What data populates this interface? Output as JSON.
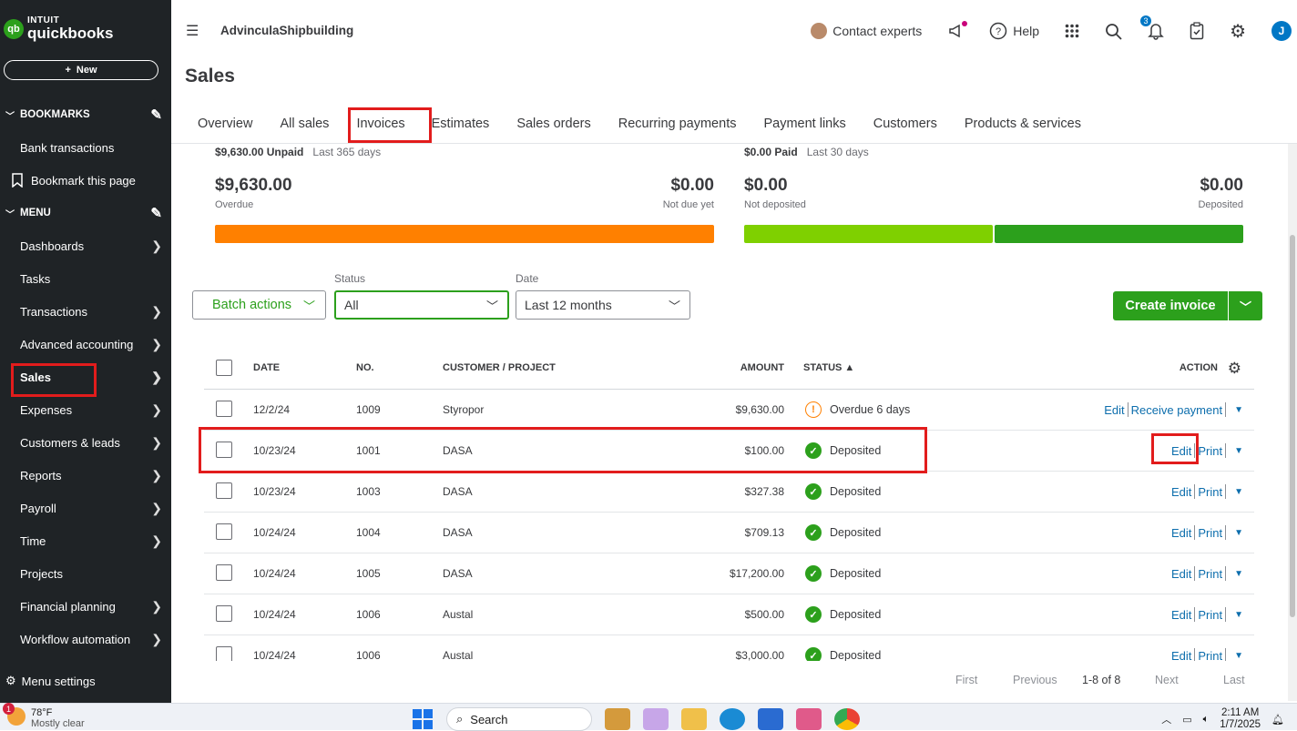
{
  "sidebar": {
    "logo_intuit": "INTUIT",
    "logo_qb": "quickbooks",
    "logo_mark": "qb",
    "new_label": "New",
    "bookmarks_label": "BOOKMARKS",
    "bookmark_items": [
      "Bank transactions",
      "Bookmark this page"
    ],
    "menu_label": "MENU",
    "menu_items": [
      "Dashboards",
      "Tasks",
      "Transactions",
      "Advanced accounting",
      "Sales",
      "Expenses",
      "Customers & leads",
      "Reports",
      "Payroll",
      "Time",
      "Projects",
      "Financial planning",
      "Workflow automation"
    ],
    "menu_settings": "Menu settings"
  },
  "topbar": {
    "company": "AdvinculaShipbuilding",
    "contact": "Contact experts",
    "help": "Help",
    "notif_count": "3",
    "user_initial": "J"
  },
  "page": {
    "title": "Sales",
    "tabs": [
      "Overview",
      "All sales",
      "Invoices",
      "Estimates",
      "Sales orders",
      "Recurring payments",
      "Payment links",
      "Customers",
      "Products & services"
    ]
  },
  "summary": {
    "unpaid_head": "$9,630.00 Unpaid",
    "unpaid_period": "Last 365 days",
    "overdue_amount": "$9,630.00",
    "overdue_label": "Overdue",
    "notdue_amount": "$0.00",
    "notdue_label": "Not due yet",
    "paid_head": "$0.00 Paid",
    "paid_period": "Last 30 days",
    "notdep_amount": "$0.00",
    "notdep_label": "Not deposited",
    "dep_amount": "$0.00",
    "dep_label": "Deposited",
    "colors": {
      "overdue": "#ff8000",
      "notdeposited": "#7fd000",
      "deposited": "#2ca01c"
    }
  },
  "filters": {
    "batch": "Batch actions",
    "status_label": "Status",
    "status_value": "All",
    "date_label": "Date",
    "date_value": "Last 12 months",
    "create": "Create invoice"
  },
  "table": {
    "headers": {
      "date": "DATE",
      "no": "NO.",
      "customer": "CUSTOMER / PROJECT",
      "amount": "AMOUNT",
      "status": "STATUS ▲",
      "action": "ACTION"
    },
    "rows": [
      {
        "date": "12/2/24",
        "no": "1009",
        "customer": "Styropor",
        "amount": "$9,630.00",
        "status": "Overdue 6 days",
        "a1": "Edit",
        "a2": "Receive payment"
      },
      {
        "date": "10/23/24",
        "no": "1001",
        "customer": "DASA",
        "amount": "$100.00",
        "status": "Deposited",
        "a1": "Edit",
        "a2": "Print"
      },
      {
        "date": "10/23/24",
        "no": "1003",
        "customer": "DASA",
        "amount": "$327.38",
        "status": "Deposited",
        "a1": "Edit",
        "a2": "Print"
      },
      {
        "date": "10/24/24",
        "no": "1004",
        "customer": "DASA",
        "amount": "$709.13",
        "status": "Deposited",
        "a1": "Edit",
        "a2": "Print"
      },
      {
        "date": "10/24/24",
        "no": "1005",
        "customer": "DASA",
        "amount": "$17,200.00",
        "status": "Deposited",
        "a1": "Edit",
        "a2": "Print"
      },
      {
        "date": "10/24/24",
        "no": "1006",
        "customer": "Austal",
        "amount": "$500.00",
        "status": "Deposited",
        "a1": "Edit",
        "a2": "Print"
      },
      {
        "date": "10/24/24",
        "no": "1006",
        "customer": "Austal",
        "amount": "$3,000.00",
        "status": "Deposited",
        "a1": "Edit",
        "a2": "Print"
      }
    ]
  },
  "pager": {
    "first": "First",
    "previous": "Previous",
    "range": "1-8 of 8",
    "next": "Next",
    "last": "Last"
  },
  "taskbar": {
    "temp": "78°F",
    "weather": "Mostly clear",
    "weather_badge": "1",
    "search": "Search",
    "time": "2:11 AM",
    "date": "1/7/2025"
  }
}
